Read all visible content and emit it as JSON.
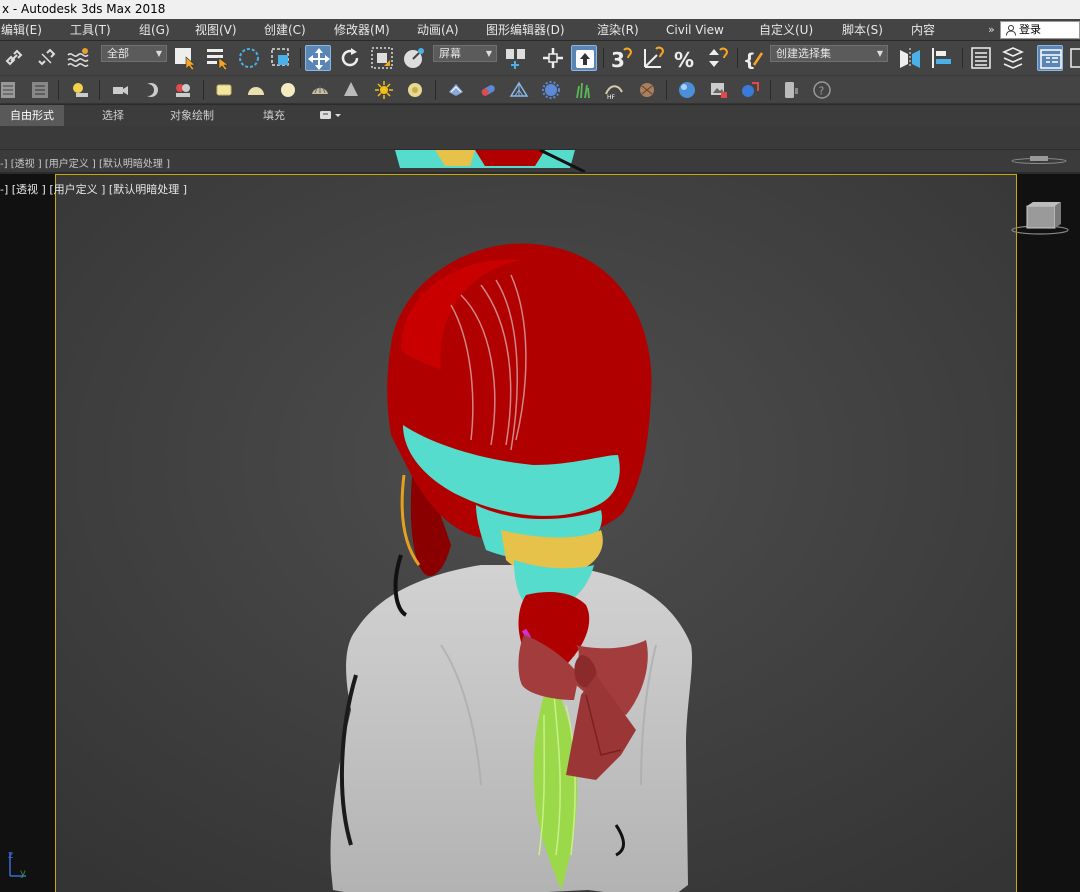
{
  "window": {
    "title": "x - Autodesk 3ds Max 2018"
  },
  "menu": {
    "items": [
      {
        "label": "编辑(E)"
      },
      {
        "label": "工具(T)"
      },
      {
        "label": "组(G)"
      },
      {
        "label": "视图(V)"
      },
      {
        "label": "创建(C)"
      },
      {
        "label": "修改器(M)"
      },
      {
        "label": "动画(A)"
      },
      {
        "label": "图形编辑器(D)"
      },
      {
        "label": "渲染(R)"
      },
      {
        "label": "Civil View"
      },
      {
        "label": "自定义(U)"
      },
      {
        "label": "脚本(S)"
      },
      {
        "label": "内容"
      }
    ],
    "overflow_glyph": "»",
    "login_label": "登录"
  },
  "toolbar": {
    "selection_filter": "全部",
    "reference_coord": "屏幕",
    "named_selection": "创建选择集",
    "accent_color": "#5a86b5"
  },
  "ribbon": {
    "tabs": [
      {
        "label": "自由形式",
        "selected": true
      },
      {
        "label": "选择"
      },
      {
        "label": "对象绘制"
      },
      {
        "label": "填充"
      }
    ]
  },
  "viewport_top": {
    "label": "-] [透视 ] [用户定义 ] [默认明暗处理 ]"
  },
  "viewport_main": {
    "label": "-] [透视 ] [用户定义 ] [默认明暗处理 ]",
    "border_color": "#c9a800"
  },
  "axis": {
    "z": "z",
    "y": "y"
  },
  "colors": {
    "hair_red": "#b00000",
    "hair_cyan": "#55dccc",
    "hair_yellow": "#e6c24a",
    "hair_magenta": "#cc33cc",
    "hair_green": "#9cd94a",
    "bow": "#a33c3c",
    "body": "#c4c4c4"
  }
}
